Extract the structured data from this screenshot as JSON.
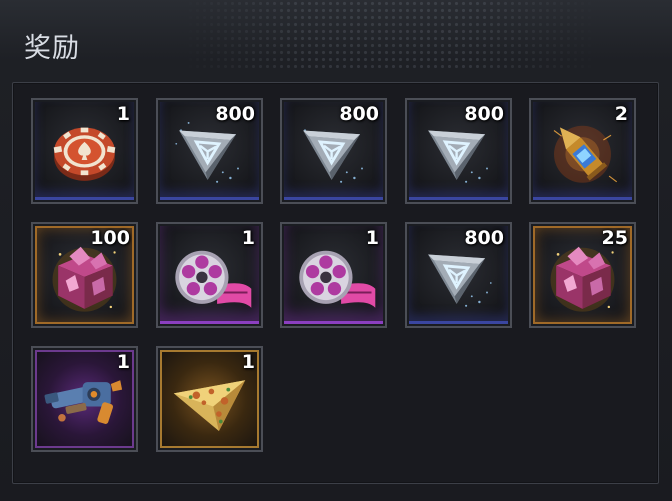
{
  "panel": {
    "title": "奖励"
  },
  "rewards": [
    {
      "icon": "casino-chip-icon",
      "qty": "1"
    },
    {
      "icon": "crystal-triangle-icon",
      "qty": "800"
    },
    {
      "icon": "crystal-triangle-icon",
      "qty": "800"
    },
    {
      "icon": "crystal-triangle-icon",
      "qty": "800"
    },
    {
      "icon": "bullet-cartridge-icon",
      "qty": "2"
    },
    {
      "icon": "pink-ore-crate-icon",
      "qty": "100"
    },
    {
      "icon": "film-reel-icon",
      "qty": "1"
    },
    {
      "icon": "film-reel-icon",
      "qty": "1"
    },
    {
      "icon": "crystal-triangle-icon",
      "qty": "800"
    },
    {
      "icon": "pink-ore-crate-icon",
      "qty": "25"
    },
    {
      "icon": "blaster-gun-icon",
      "qty": "1"
    },
    {
      "icon": "paper-plane-icon",
      "qty": "1"
    }
  ],
  "colors": {
    "blue_rarity": "#3a46a0",
    "purple_rarity": "#8b3fc0",
    "gold_rarity": "#a06a28"
  }
}
